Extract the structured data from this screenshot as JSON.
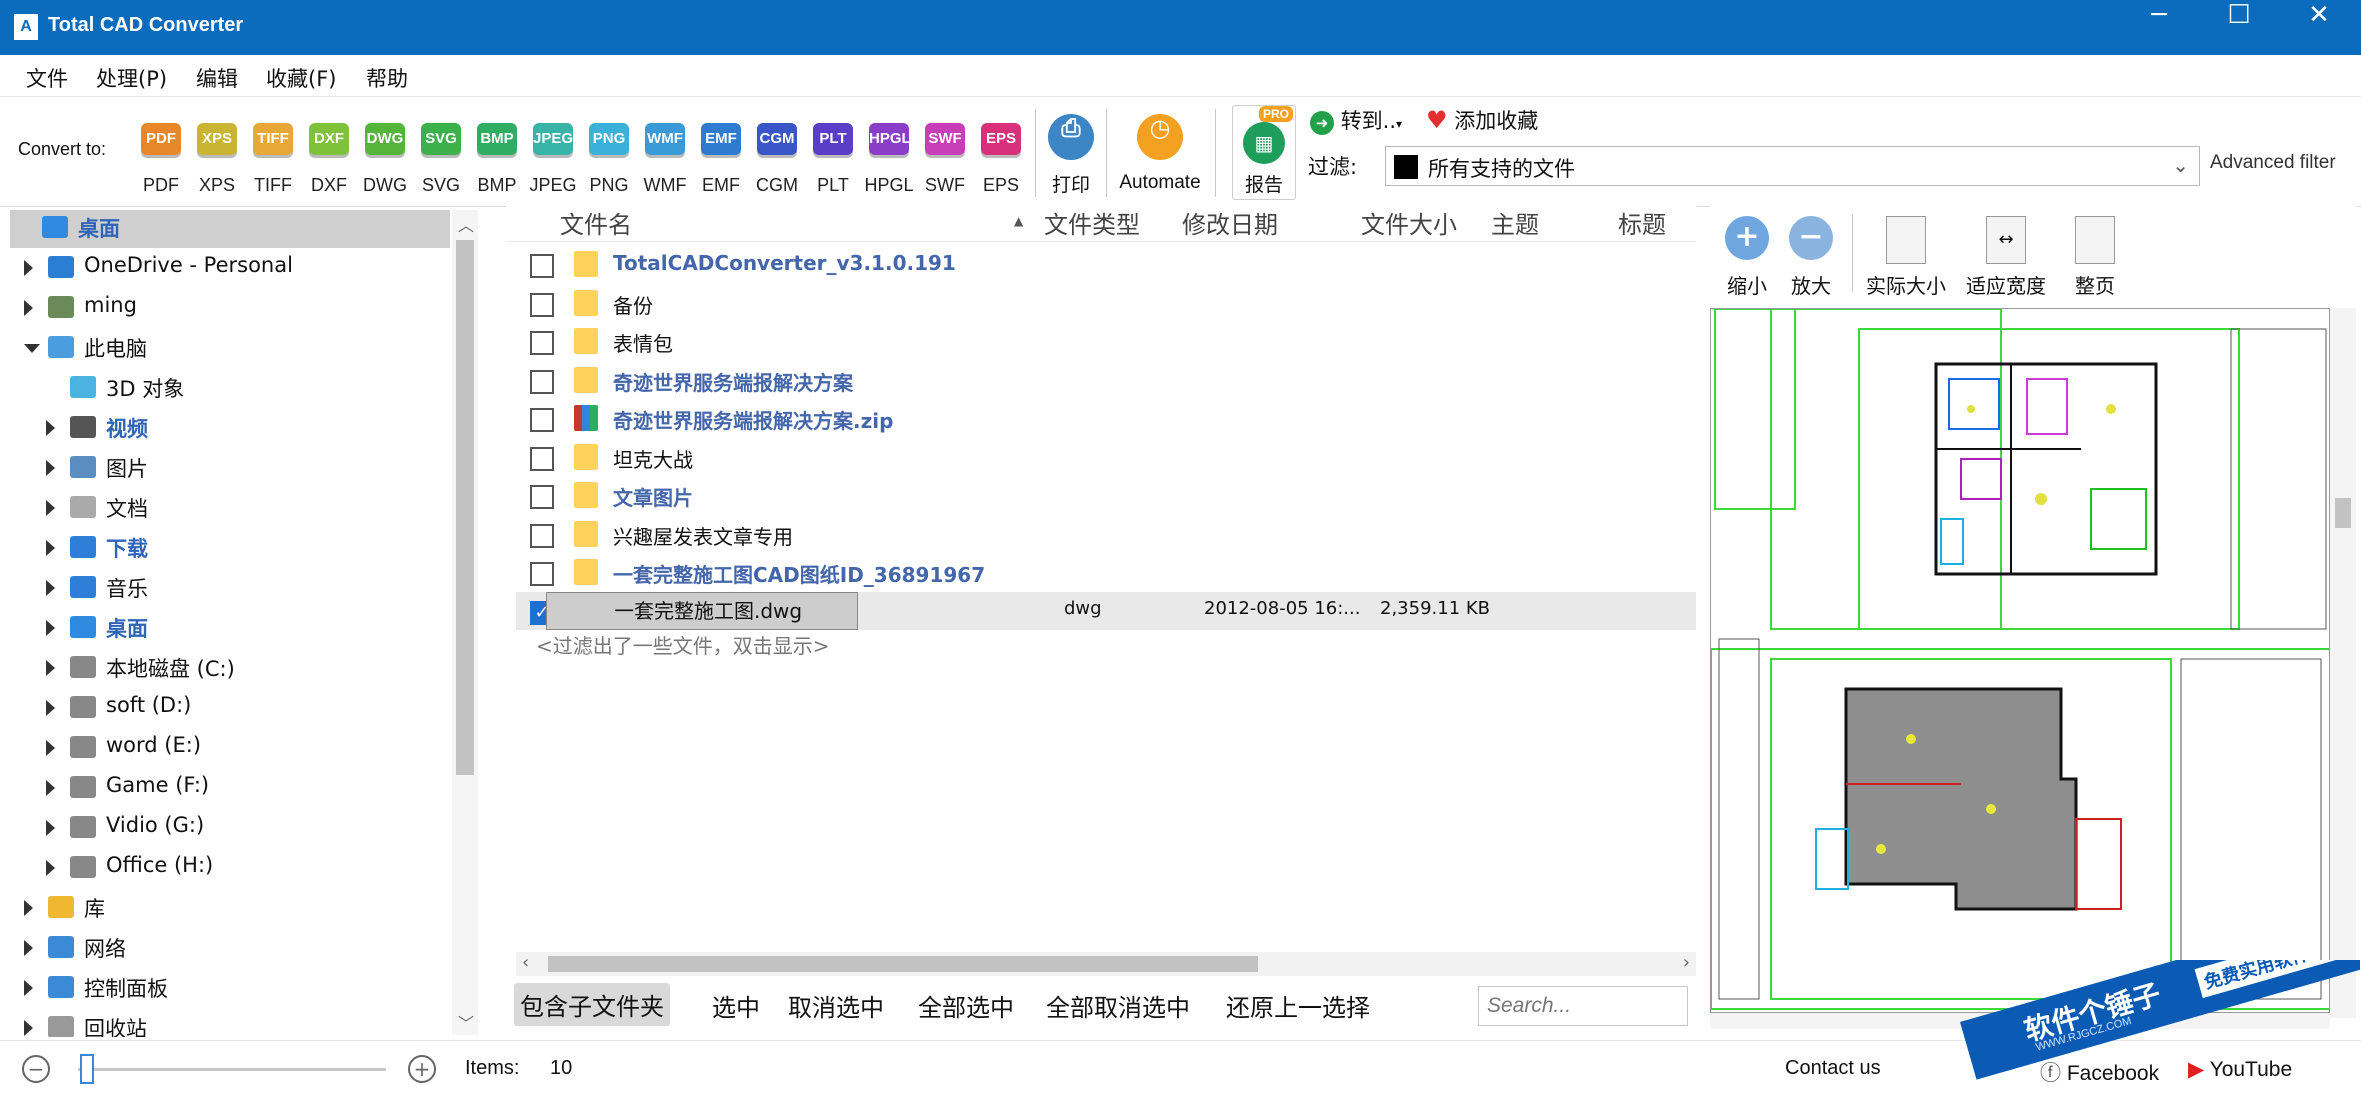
{
  "window": {
    "title": "Total CAD Converter",
    "minimize": "─",
    "maximize": "☐",
    "close": "✕"
  },
  "menu": [
    "文件",
    "处理(P)",
    "编辑",
    "收藏(F)",
    "帮助"
  ],
  "toolbar": {
    "convert_to_label": "Convert to:",
    "formats": [
      {
        "label": "PDF",
        "color": "#e8872a"
      },
      {
        "label": "XPS",
        "color": "#c9b531"
      },
      {
        "label": "TIFF",
        "color": "#e8a838"
      },
      {
        "label": "DXF",
        "color": "#7fc23a"
      },
      {
        "label": "DWG",
        "color": "#55b43a"
      },
      {
        "label": "SVG",
        "color": "#3cb04a"
      },
      {
        "label": "BMP",
        "color": "#2fae63"
      },
      {
        "label": "JPEG",
        "color": "#38b3a8"
      },
      {
        "label": "PNG",
        "color": "#3bb0d8"
      },
      {
        "label": "WMF",
        "color": "#3a9ad8"
      },
      {
        "label": "EMF",
        "color": "#2f7bd0"
      },
      {
        "label": "CGM",
        "color": "#3a55c8"
      },
      {
        "label": "PLT",
        "color": "#5a3ec8"
      },
      {
        "label": "HPGL",
        "color": "#8a3ec8"
      },
      {
        "label": "SWF",
        "color": "#c83eb8"
      },
      {
        "label": "EPS",
        "color": "#d8307a"
      }
    ],
    "print_label": "打印",
    "automate_label": "Automate",
    "report_label": "报告",
    "pro_badge": "PRO",
    "goto_label": "转到..",
    "favorite_label": "添加收藏",
    "filter_label": "过滤:",
    "filter_value": "所有支持的文件",
    "advanced_filter": "Advanced filter"
  },
  "tree": {
    "items": [
      {
        "label": "桌面",
        "level": 0,
        "expand": "none",
        "bold": true,
        "selected": true,
        "icon": "desktop-icon"
      },
      {
        "label": "OneDrive - Personal",
        "level": 1,
        "expand": "right",
        "icon": "cloud-icon"
      },
      {
        "label": "ming",
        "level": 1,
        "expand": "right",
        "icon": "user-icon"
      },
      {
        "label": "此电脑",
        "level": 1,
        "expand": "down",
        "icon": "computer-icon"
      },
      {
        "label": "3D 对象",
        "level": 2,
        "expand": "none",
        "icon": "cube-icon"
      },
      {
        "label": "视频",
        "level": 2,
        "expand": "right",
        "bold": true,
        "icon": "video-icon"
      },
      {
        "label": "图片",
        "level": 2,
        "expand": "right",
        "icon": "pictures-icon"
      },
      {
        "label": "文档",
        "level": 2,
        "expand": "right",
        "icon": "documents-icon"
      },
      {
        "label": "下载",
        "level": 2,
        "expand": "right",
        "bold": true,
        "icon": "download-icon"
      },
      {
        "label": "音乐",
        "level": 2,
        "expand": "right",
        "icon": "music-icon"
      },
      {
        "label": "桌面",
        "level": 2,
        "expand": "right",
        "bold": true,
        "icon": "desktop-icon"
      },
      {
        "label": "本地磁盘 (C:)",
        "level": 2,
        "expand": "right",
        "icon": "drive-icon"
      },
      {
        "label": "soft (D:)",
        "level": 2,
        "expand": "right",
        "icon": "drive-icon"
      },
      {
        "label": "word (E:)",
        "level": 2,
        "expand": "right",
        "icon": "drive-icon"
      },
      {
        "label": "Game (F:)",
        "level": 2,
        "expand": "right",
        "icon": "drive-icon"
      },
      {
        "label": "Vidio (G:)",
        "level": 2,
        "expand": "right",
        "icon": "drive-icon"
      },
      {
        "label": "Office (H:)",
        "level": 2,
        "expand": "right",
        "icon": "drive-icon"
      },
      {
        "label": "库",
        "level": 1,
        "expand": "right",
        "icon": "library-icon"
      },
      {
        "label": "网络",
        "level": 1,
        "expand": "right",
        "icon": "network-icon"
      },
      {
        "label": "控制面板",
        "level": 1,
        "expand": "right",
        "icon": "control-panel-icon"
      },
      {
        "label": "回收站",
        "level": 1,
        "expand": "right",
        "icon": "recycle-bin-icon"
      }
    ]
  },
  "filelist": {
    "columns": [
      "文件名",
      "文件类型",
      "修改日期",
      "文件大小",
      "主题",
      "标题"
    ],
    "rows": [
      {
        "name": "TotalCADConverter_v3.1.0.191",
        "kind": "folder",
        "bold": true
      },
      {
        "name": "备份",
        "kind": "folder",
        "bold": false
      },
      {
        "name": "表情包",
        "kind": "folder",
        "bold": false
      },
      {
        "name": "奇迹世界服务端报解决方案",
        "kind": "folder",
        "bold": true
      },
      {
        "name": "奇迹世界服务端报解决方案.zip",
        "kind": "zip",
        "bold": true
      },
      {
        "name": "坦克大战",
        "kind": "folder",
        "bold": false
      },
      {
        "name": "文章图片",
        "kind": "folder",
        "bold": true
      },
      {
        "name": "兴趣屋发表文章专用",
        "kind": "folder",
        "bold": false
      },
      {
        "name": "一套完整施工图CAD图纸ID_36891967",
        "kind": "folder",
        "bold": true
      },
      {
        "name": "一套完整施工图.dwg",
        "kind": "file",
        "bold": false,
        "checked": true,
        "type": "dwg",
        "date": "2012-08-05 16:...",
        "size": "2,359.11 KB"
      }
    ],
    "filtered_note": "<过滤出了一些文件，双击显示>"
  },
  "bottom_buttons": [
    "包含子文件夹",
    "选中",
    "取消选中",
    "全部选中",
    "全部取消选中",
    "还原上一选择"
  ],
  "search_placeholder": "Search...",
  "preview": {
    "buttons": [
      "缩小",
      "放大",
      "实际大小",
      "适应宽度",
      "整页"
    ]
  },
  "status": {
    "items_label": "Items:",
    "items_count": "10",
    "contact": "Contact us",
    "facebook": "Facebook",
    "youtube": "YouTube"
  },
  "watermark": {
    "title": "软件个锤子",
    "subtitle": "免费实用软件站",
    "url": "WWW.RJGCZ.COM"
  }
}
